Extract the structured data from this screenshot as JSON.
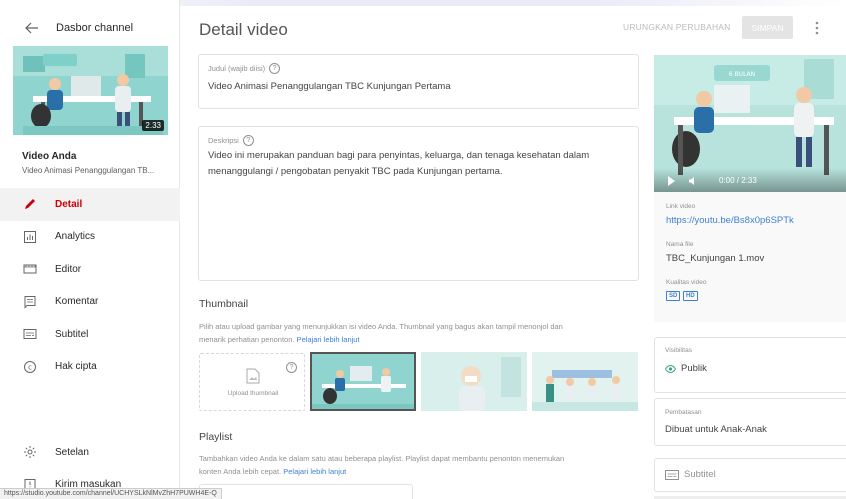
{
  "sidebar": {
    "title": "Dasbor channel",
    "thumbnail_duration": "2.33",
    "thumbnail_badge": "6 BULAN",
    "your_video_label": "Video Anda",
    "video_title_truncated": "Video Animasi Penanggulangan TB...",
    "nav_items": [
      {
        "label": "Detail",
        "icon": "pencil-icon",
        "active": true
      },
      {
        "label": "Analytics",
        "icon": "analytics-icon",
        "active": false
      },
      {
        "label": "Editor",
        "icon": "editor-icon",
        "active": false
      },
      {
        "label": "Komentar",
        "icon": "comment-icon",
        "active": false
      },
      {
        "label": "Subtitel",
        "icon": "subtitles-icon",
        "active": false
      },
      {
        "label": "Hak cipta",
        "icon": "copyright-icon",
        "active": false
      }
    ],
    "bottom_items": [
      {
        "label": "Setelan",
        "icon": "settings-icon"
      },
      {
        "label": "Kirim masukan",
        "icon": "feedback-icon"
      }
    ]
  },
  "status_url": "https://studio.youtube.com/channel/UCHYSLkNlMvZhH7PUWH4E-Q",
  "header": {
    "title": "Detail video",
    "undo_label": "URUNGKAN PERUBAHAN",
    "save_label": "SIMPAN"
  },
  "form": {
    "title_label": "Judul (wajib diisi)",
    "title_value": "Video Animasi Penanggulangan TBC Kunjungan Pertama",
    "description_label": "Deskripsi",
    "description_line1": "Video ini merupakan panduan bagi para penyintas, keluarga, dan tenaga kesehatan dalam",
    "description_line2": "menanggulangi / pengobatan penyakit TBC pada Kunjungan pertama."
  },
  "thumbnail": {
    "title": "Thumbnail",
    "desc_line1": "Pilih atau upload gambar yang menunjukkan isi video Anda. Thumbnail yang bagus akan tampil menonjol dan",
    "desc_line2": "menarik perhatian penonton.",
    "learn_more": "Pelajari lebih lanjut",
    "upload_label": "Upload thumbnail"
  },
  "playlist": {
    "title": "Playlist",
    "desc_line1": "Tambahkan video Anda ke dalam satu atau beberapa playlist. Playlist dapat membantu penonton menemukan",
    "desc_line2": "konten Anda lebih cepat.",
    "learn_more": "Pelajari lebih lanjut"
  },
  "preview": {
    "badge": "6 BULAN",
    "time": "0:00 / 2:33"
  },
  "info": {
    "link_label": "Link video",
    "link_value": "https://youtu.be/Bs8x0p6SPTk",
    "filename_label": "Nama file",
    "filename_value": "TBC_Kunjungan 1.mov",
    "quality_label": "Kualitas video",
    "quality_badges": [
      "SD",
      "HD"
    ]
  },
  "visibility": {
    "label": "Visibilitas",
    "value": "Publik"
  },
  "restrictions": {
    "label": "Pembatasan",
    "value": "Dibuat untuk Anak-Anak"
  },
  "subtitles_box": {
    "label": "Subtitel"
  },
  "colors": {
    "accent_red": "#cc0000",
    "link_blue": "#3e7fd8",
    "thumb_teal": "#8fd4cf"
  }
}
